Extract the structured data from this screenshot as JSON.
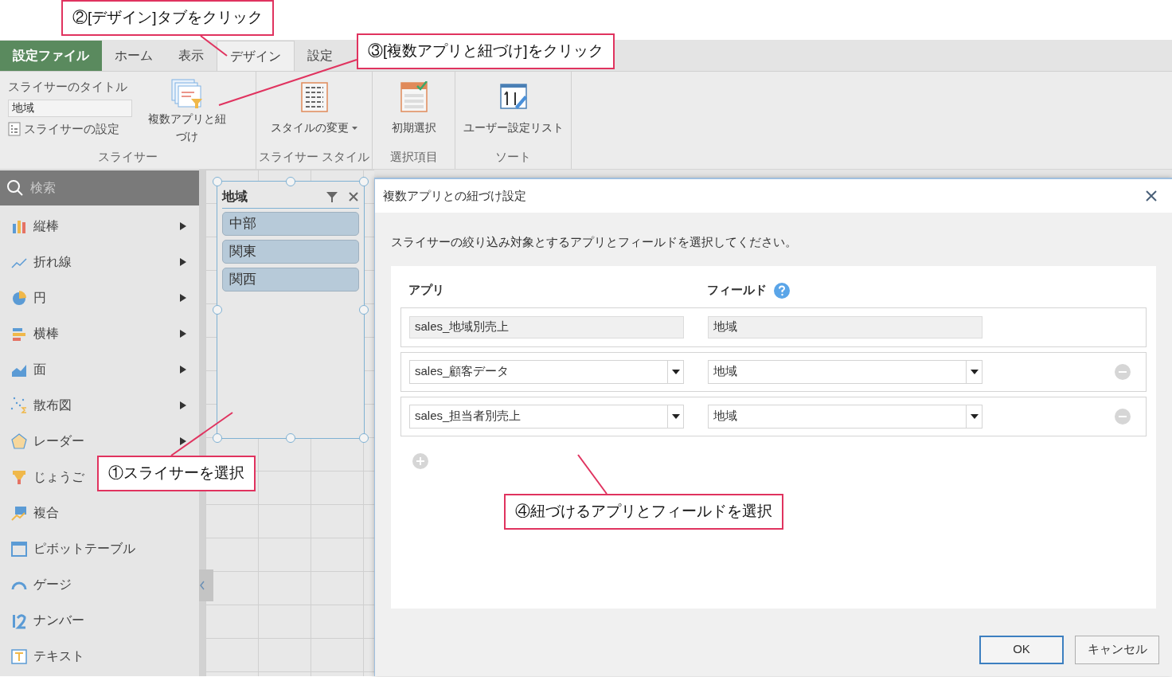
{
  "tabs": [
    {
      "label": "設定ファイル",
      "kind": "file",
      "selected": false
    },
    {
      "label": "ホーム",
      "kind": "tab",
      "selected": false
    },
    {
      "label": "表示",
      "kind": "tab",
      "selected": false
    },
    {
      "label": "デザイン",
      "kind": "tab",
      "selected": true
    },
    {
      "label": "設定",
      "kind": "tab",
      "selected": false
    }
  ],
  "ribbon": {
    "slicer_group": {
      "title_label": "スライサーのタイトル",
      "title_value": "地域",
      "settings_label": "スライサーの設定",
      "link_button": "複数アプリと紐づけ",
      "group_label": "スライサー"
    },
    "groups": [
      {
        "button": "スタイルの変更",
        "dropdown": true,
        "group_label": "スライサー スタイル"
      },
      {
        "button": "初期選択",
        "dropdown": false,
        "group_label": "選択項目"
      },
      {
        "button": "ユーザー設定リスト",
        "dropdown": false,
        "group_label": "ソート"
      }
    ]
  },
  "sidebar": {
    "search_placeholder": "検索",
    "items": [
      {
        "label": "縦棒",
        "submenu": true
      },
      {
        "label": "折れ線",
        "submenu": true
      },
      {
        "label": "円",
        "submenu": true
      },
      {
        "label": "横棒",
        "submenu": true
      },
      {
        "label": "面",
        "submenu": true
      },
      {
        "label": "散布図",
        "submenu": true
      },
      {
        "label": "レーダー",
        "submenu": true
      },
      {
        "label": "じょうご",
        "submenu": false
      },
      {
        "label": "複合",
        "submenu": false
      },
      {
        "label": "ピボットテーブル",
        "submenu": false
      },
      {
        "label": "ゲージ",
        "submenu": false
      },
      {
        "label": "ナンバー",
        "submenu": false
      },
      {
        "label": "テキスト",
        "submenu": false
      }
    ]
  },
  "slicer": {
    "title": "地域",
    "items": [
      "中部",
      "関東",
      "関西"
    ]
  },
  "dialog": {
    "title": "複数アプリとの紐づけ設定",
    "instruction": "スライサーの絞り込み対象とするアプリとフィールドを選択してください。",
    "app_header": "アプリ",
    "field_header": "フィールド",
    "rows": [
      {
        "app": "sales_地域別売上",
        "field": "地域",
        "kind": "fixed"
      },
      {
        "app": "sales_顧客データ",
        "field": "地域",
        "kind": "select"
      },
      {
        "app": "sales_担当者別売上",
        "field": "地域",
        "kind": "select"
      }
    ],
    "ok": "OK",
    "cancel": "キャンセル"
  },
  "annotations": [
    "②[デザイン]タブをクリック",
    "③[複数アプリと紐づけ]をクリック",
    "①スライサーを選択",
    "④紐づけるアプリとフィールドを選択"
  ]
}
